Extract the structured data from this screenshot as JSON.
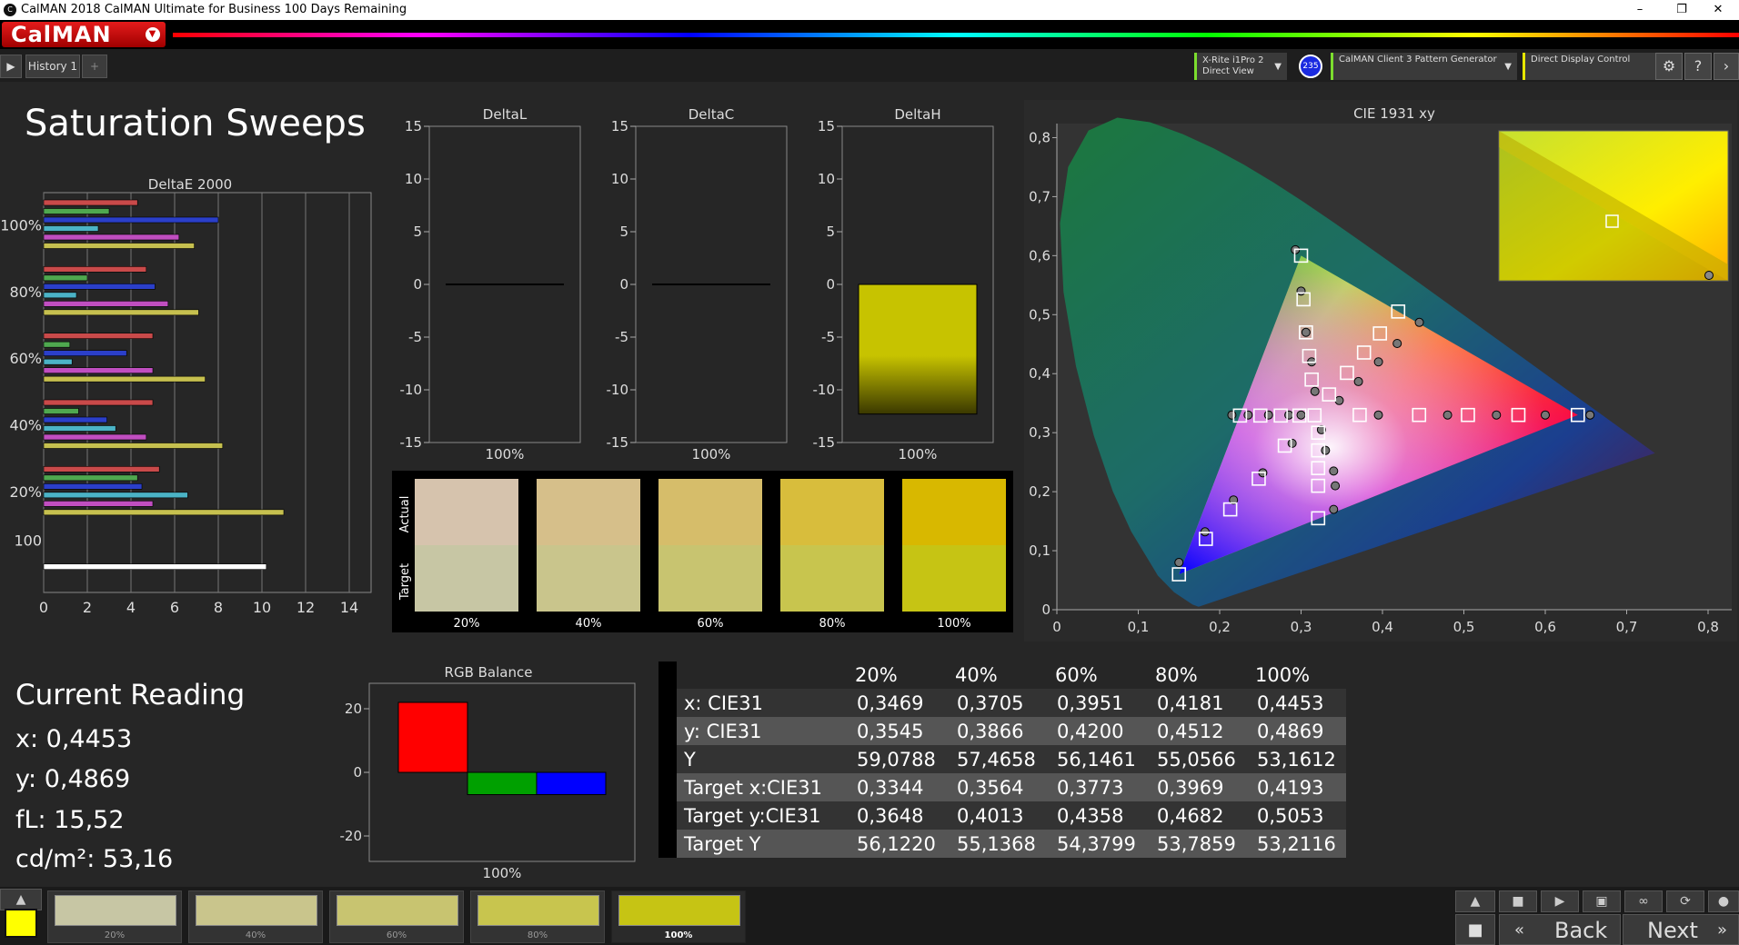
{
  "window": {
    "title": "CalMAN 2018 CalMAN Ultimate for Business 100 Days Remaining",
    "app_icon_text": "C",
    "minimize": "–",
    "maximize": "❐",
    "close": "✕"
  },
  "brand": {
    "logo": "CalMAN"
  },
  "tabs": {
    "history_label": "History 1",
    "add_label": "+"
  },
  "devices": {
    "meter_line1": "X-Rite i1Pro 2",
    "meter_line2": "Direct View",
    "meter_badge": "235",
    "generator": "CalMAN Client 3 Pattern Generator",
    "display": "Direct Display Control"
  },
  "page_title": "Saturation Sweeps",
  "deltae_chart": {
    "title": "DeltaE 2000",
    "type": "bar",
    "x_ticks": [
      "0",
      "2",
      "4",
      "6",
      "8",
      "10",
      "12",
      "14"
    ],
    "xlim": [
      0,
      15
    ],
    "groups": [
      {
        "label": "100%",
        "series": [
          {
            "color": "#c94a4a",
            "value": 4.3
          },
          {
            "color": "#4fa84f",
            "value": 3.0
          },
          {
            "color": "#2b3fc9",
            "value": 8.0
          },
          {
            "color": "#4bb3c6",
            "value": 2.5
          },
          {
            "color": "#c04ec0",
            "value": 6.2
          },
          {
            "color": "#c6c04f",
            "value": 6.9
          }
        ]
      },
      {
        "label": "80%",
        "series": [
          {
            "color": "#c94a4a",
            "value": 4.7
          },
          {
            "color": "#4fa84f",
            "value": 2.0
          },
          {
            "color": "#2b3fc9",
            "value": 5.1
          },
          {
            "color": "#4bb3c6",
            "value": 1.5
          },
          {
            "color": "#c04ec0",
            "value": 5.7
          },
          {
            "color": "#c6c04f",
            "value": 7.1
          }
        ]
      },
      {
        "label": "60%",
        "series": [
          {
            "color": "#c94a4a",
            "value": 5.0
          },
          {
            "color": "#4fa84f",
            "value": 1.2
          },
          {
            "color": "#2b3fc9",
            "value": 3.8
          },
          {
            "color": "#4bb3c6",
            "value": 1.3
          },
          {
            "color": "#c04ec0",
            "value": 5.0
          },
          {
            "color": "#c6c04f",
            "value": 7.4
          }
        ]
      },
      {
        "label": "40%",
        "series": [
          {
            "color": "#c94a4a",
            "value": 5.0
          },
          {
            "color": "#4fa84f",
            "value": 1.6
          },
          {
            "color": "#2b3fc9",
            "value": 2.9
          },
          {
            "color": "#4bb3c6",
            "value": 3.3
          },
          {
            "color": "#c04ec0",
            "value": 4.7
          },
          {
            "color": "#c6c04f",
            "value": 8.2
          }
        ]
      },
      {
        "label": "20%",
        "series": [
          {
            "color": "#c94a4a",
            "value": 5.3
          },
          {
            "color": "#4fa84f",
            "value": 4.3
          },
          {
            "color": "#2b3fc9",
            "value": 4.5
          },
          {
            "color": "#4bb3c6",
            "value": 6.6
          },
          {
            "color": "#c04ec0",
            "value": 5.0
          },
          {
            "color": "#c6c04f",
            "value": 11.0
          }
        ]
      },
      {
        "label": "100",
        "series": [
          {
            "color": "#ffffff",
            "value": 10.2
          }
        ]
      }
    ]
  },
  "delta_charts": [
    {
      "title": "DeltaL",
      "y_ticks": [
        "15",
        "10",
        "5",
        "0",
        "-5",
        "-10",
        "-15"
      ],
      "ylim": [
        -15,
        15
      ],
      "value": 0,
      "category": "100%",
      "bar_color": "#222222"
    },
    {
      "title": "DeltaC",
      "y_ticks": [
        "15",
        "10",
        "5",
        "0",
        "-5",
        "-10",
        "-15"
      ],
      "ylim": [
        -15,
        15
      ],
      "value": 0,
      "category": "100%",
      "bar_color": "#222222"
    },
    {
      "title": "DeltaH",
      "y_ticks": [
        "15",
        "10",
        "5",
        "0",
        "-5",
        "-10",
        "-15"
      ],
      "ylim": [
        -15,
        15
      ],
      "value": -12.3,
      "category": "100%",
      "bar_color": "#c7c300"
    }
  ],
  "swatches": {
    "actual_label": "Actual",
    "target_label": "Target",
    "items": [
      {
        "label": "20%",
        "actual": "#d6c3ad",
        "target": "#c7c6a4"
      },
      {
        "label": "40%",
        "actual": "#d6bf8a",
        "target": "#c9c58c"
      },
      {
        "label": "60%",
        "actual": "#d6bd6a",
        "target": "#c8c470"
      },
      {
        "label": "80%",
        "actual": "#d8bd3c",
        "target": "#c8c54e"
      },
      {
        "label": "100%",
        "actual": "#d8b800",
        "target": "#c6c414"
      }
    ]
  },
  "cie_chart": {
    "title": "CIE 1931 xy",
    "x_ticks": [
      "0",
      "0,1",
      "0,2",
      "0,3",
      "0,4",
      "0,5",
      "0,6",
      "0,7",
      "0,8"
    ],
    "y_ticks": [
      "0",
      "0,1",
      "0,2",
      "0,3",
      "0,4",
      "0,5",
      "0,6",
      "0,7",
      "0,8"
    ],
    "xlim": [
      0,
      0.8
    ],
    "ylim": [
      0,
      0.85
    ],
    "targets": [
      [
        0.15,
        0.06
      ],
      [
        0.183,
        0.12
      ],
      [
        0.213,
        0.17
      ],
      [
        0.248,
        0.222
      ],
      [
        0.28,
        0.278
      ],
      [
        0.3,
        0.6
      ],
      [
        0.303,
        0.526
      ],
      [
        0.306,
        0.47
      ],
      [
        0.31,
        0.43
      ],
      [
        0.313,
        0.39
      ],
      [
        0.64,
        0.33
      ],
      [
        0.567,
        0.33
      ],
      [
        0.505,
        0.33
      ],
      [
        0.445,
        0.33
      ],
      [
        0.372,
        0.33
      ],
      [
        0.3344,
        0.3648
      ],
      [
        0.3564,
        0.4013
      ],
      [
        0.3773,
        0.4358
      ],
      [
        0.3969,
        0.4682
      ],
      [
        0.4193,
        0.5053
      ],
      [
        0.225,
        0.329
      ],
      [
        0.25,
        0.329
      ],
      [
        0.275,
        0.329
      ],
      [
        0.298,
        0.329
      ],
      [
        0.3165,
        0.3294
      ],
      [
        0.321,
        0.3
      ],
      [
        0.321,
        0.27
      ],
      [
        0.321,
        0.24
      ],
      [
        0.321,
        0.21
      ],
      [
        0.321,
        0.155
      ]
    ],
    "measured": [
      [
        0.15,
        0.08
      ],
      [
        0.182,
        0.132
      ],
      [
        0.217,
        0.186
      ],
      [
        0.253,
        0.232
      ],
      [
        0.289,
        0.282
      ],
      [
        0.293,
        0.61
      ],
      [
        0.3,
        0.54
      ],
      [
        0.306,
        0.47
      ],
      [
        0.313,
        0.42
      ],
      [
        0.317,
        0.37
      ],
      [
        0.655,
        0.33
      ],
      [
        0.6,
        0.33
      ],
      [
        0.54,
        0.33
      ],
      [
        0.48,
        0.33
      ],
      [
        0.395,
        0.33
      ],
      [
        0.3469,
        0.3545
      ],
      [
        0.3705,
        0.3866
      ],
      [
        0.3951,
        0.42
      ],
      [
        0.4181,
        0.4512
      ],
      [
        0.4453,
        0.4869
      ],
      [
        0.215,
        0.33
      ],
      [
        0.235,
        0.33
      ],
      [
        0.26,
        0.33
      ],
      [
        0.285,
        0.33
      ],
      [
        0.3,
        0.33
      ],
      [
        0.325,
        0.305
      ],
      [
        0.33,
        0.27
      ],
      [
        0.34,
        0.235
      ],
      [
        0.342,
        0.21
      ],
      [
        0.34,
        0.17
      ]
    ]
  },
  "current_reading": {
    "title": "Current Reading",
    "x": "x: 0,4453",
    "y": "y: 0,4869",
    "fl": "fL: 15,52",
    "cdm2": "cd/m²: 53,16"
  },
  "rgb_balance": {
    "title": "RGB Balance",
    "y_ticks": [
      "20",
      "0",
      "-20"
    ],
    "ylim": [
      -28,
      28
    ],
    "category": "100%",
    "bars": [
      {
        "color": "#ff0000",
        "value": 22
      },
      {
        "color": "#00a000",
        "value": -7
      },
      {
        "color": "#0000ff",
        "value": -7
      }
    ]
  },
  "table": {
    "columns": [
      "20%",
      "40%",
      "60%",
      "80%",
      "100%"
    ],
    "rows": [
      {
        "label": "x: CIE31",
        "values": [
          "0,3469",
          "0,3705",
          "0,3951",
          "0,4181",
          "0,4453"
        ]
      },
      {
        "label": "y: CIE31",
        "values": [
          "0,3545",
          "0,3866",
          "0,4200",
          "0,4512",
          "0,4869"
        ]
      },
      {
        "label": "Y",
        "values": [
          "59,0788",
          "57,4658",
          "56,1461",
          "55,0566",
          "53,1612"
        ]
      },
      {
        "label": "Target x:CIE31",
        "values": [
          "0,3344",
          "0,3564",
          "0,3773",
          "0,3969",
          "0,4193"
        ]
      },
      {
        "label": "Target y:CIE31",
        "values": [
          "0,3648",
          "0,4013",
          "0,4358",
          "0,4682",
          "0,5053"
        ]
      },
      {
        "label": "Target Y",
        "values": [
          "56,1220",
          "55,1368",
          "54,3799",
          "53,7859",
          "53,2116"
        ]
      }
    ]
  },
  "sweep_buttons": [
    {
      "label": "20%",
      "color": "#c7c6a4"
    },
    {
      "label": "40%",
      "color": "#c9c58c"
    },
    {
      "label": "60%",
      "color": "#c8c470"
    },
    {
      "label": "80%",
      "color": "#c8c54e"
    },
    {
      "label": "100%",
      "color": "#c6c414"
    }
  ],
  "current_color": "#ffff00",
  "nav": {
    "back": "Back",
    "next": "Next"
  }
}
